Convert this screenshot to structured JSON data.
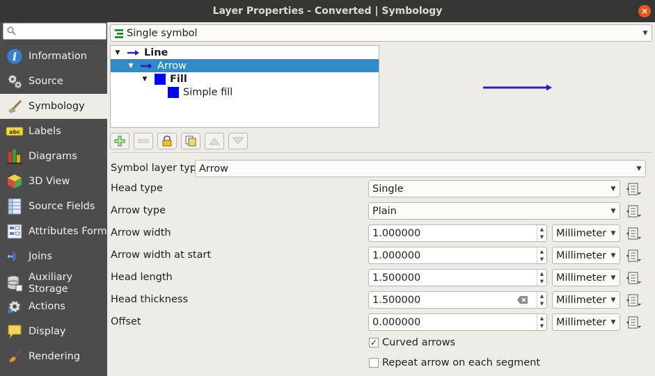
{
  "window": {
    "title": "Layer Properties - Converted | Symbology",
    "close_glyph": "×"
  },
  "sidebar": {
    "search_placeholder": "",
    "items": [
      {
        "label": "Information",
        "icon": "information-icon"
      },
      {
        "label": "Source",
        "icon": "source-icon"
      },
      {
        "label": "Symbology",
        "icon": "symbology-icon"
      },
      {
        "label": "Labels",
        "icon": "labels-icon"
      },
      {
        "label": "Diagrams",
        "icon": "diagrams-icon"
      },
      {
        "label": "3D View",
        "icon": "3d-view-icon"
      },
      {
        "label": "Source Fields",
        "icon": "source-fields-icon"
      },
      {
        "label": "Attributes Form",
        "icon": "attributes-form-icon"
      },
      {
        "label": "Joins",
        "icon": "joins-icon"
      },
      {
        "label": "Auxiliary Storage",
        "icon": "auxiliary-storage-icon"
      },
      {
        "label": "Actions",
        "icon": "actions-icon"
      },
      {
        "label": "Display",
        "icon": "display-icon"
      },
      {
        "label": "Rendering",
        "icon": "rendering-icon"
      }
    ],
    "active": "Symbology"
  },
  "renderer": {
    "value": "Single symbol"
  },
  "symbol_tree": [
    {
      "label": "Line",
      "bold": true
    },
    {
      "label": "Arrow",
      "selected": true
    },
    {
      "label": "Fill",
      "bold": true
    },
    {
      "label": "Simple fill"
    }
  ],
  "colors": {
    "arrow": "#2a1fb8",
    "fill": "#0000ff",
    "selection": "#308cc6"
  },
  "symbol_layer_type": {
    "label": "Symbol layer type",
    "value": "Arrow"
  },
  "properties": {
    "head_type": {
      "label": "Head type",
      "value": "Single"
    },
    "arrow_type": {
      "label": "Arrow type",
      "value": "Plain"
    },
    "arrow_width": {
      "label": "Arrow width",
      "value": "1.000000",
      "unit": "Millimeter"
    },
    "arrow_width_start": {
      "label": "Arrow width at start",
      "value": "1.000000",
      "unit": "Millimeter"
    },
    "head_length": {
      "label": "Head length",
      "value": "1.500000",
      "unit": "Millimeter"
    },
    "head_thickness": {
      "label": "Head thickness",
      "value": "1.500000",
      "unit": "Millimeter"
    },
    "offset": {
      "label": "Offset",
      "value": "0.000000",
      "unit": "Millimeter"
    }
  },
  "checkboxes": {
    "curved": {
      "label": "Curved arrows",
      "checked": true,
      "mark": "✓"
    },
    "repeat": {
      "label": "Repeat arrow on each segment",
      "checked": false
    }
  }
}
